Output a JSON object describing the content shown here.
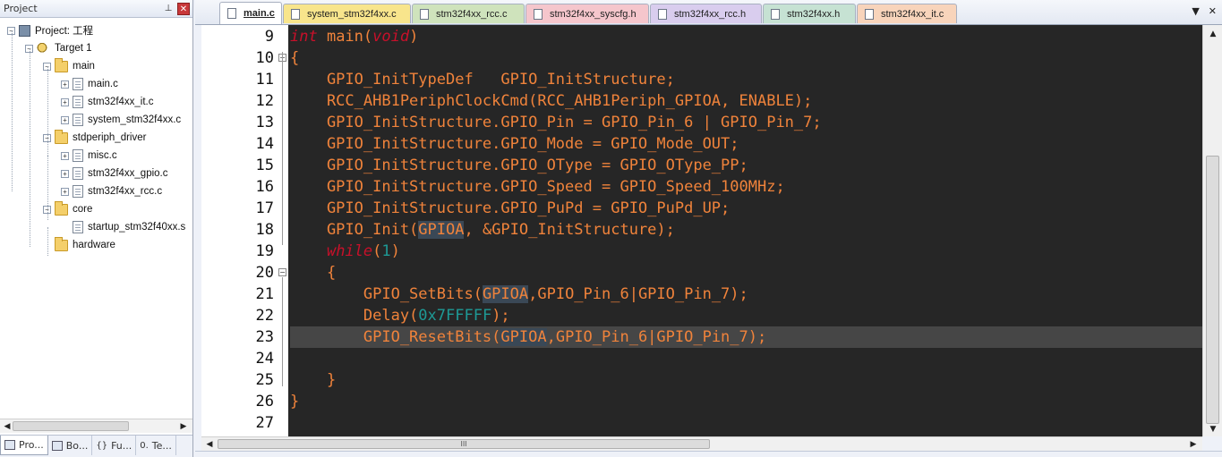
{
  "project_panel": {
    "title": "Project",
    "pin_glyph": "⊥",
    "close_glyph": "✕",
    "tree": [
      {
        "label": "Project: 工程",
        "icon": "project-icon",
        "expander": "−"
      },
      {
        "label": "Target 1",
        "icon": "target-icon",
        "expander": "−"
      },
      {
        "label": "main",
        "icon": "folder-icon",
        "expander": "−"
      },
      {
        "label": "main.c",
        "icon": "file-icon",
        "expander": "+"
      },
      {
        "label": "stm32f4xx_it.c",
        "icon": "file-icon",
        "expander": "+"
      },
      {
        "label": "system_stm32f4xx.c",
        "icon": "file-icon",
        "expander": "+"
      },
      {
        "label": "stdperiph_driver",
        "icon": "folder-icon",
        "expander": "−"
      },
      {
        "label": "misc.c",
        "icon": "file-icon",
        "expander": "+"
      },
      {
        "label": "stm32f4xx_gpio.c",
        "icon": "file-icon",
        "expander": "+"
      },
      {
        "label": "stm32f4xx_rcc.c",
        "icon": "file-icon",
        "expander": "+"
      },
      {
        "label": "core",
        "icon": "folder-icon",
        "expander": "−"
      },
      {
        "label": "startup_stm32f40xx.s",
        "icon": "file-icon",
        "expander": ""
      },
      {
        "label": "hardware",
        "icon": "folder-icon",
        "expander": ""
      }
    ],
    "bottom_tabs": [
      {
        "label": "Pro...",
        "icon": "project-tab-icon"
      },
      {
        "label": "Bo...",
        "icon": "books-tab-icon"
      },
      {
        "label": "Fu...",
        "icon": "functions-tab-icon",
        "glyph": "{}"
      },
      {
        "label": "Te...",
        "icon": "templates-tab-icon",
        "glyph": "0."
      }
    ]
  },
  "editor_tabs": [
    {
      "label": "main.c",
      "color": "#ffffff",
      "active": true
    },
    {
      "label": "system_stm32f4xx.c",
      "color": "#f8e58c"
    },
    {
      "label": "stm32f4xx_rcc.c",
      "color": "#cfe3bc"
    },
    {
      "label": "stm32f4xx_syscfg.h",
      "color": "#f5c6cc"
    },
    {
      "label": "stm32f4xx_rcc.h",
      "color": "#d9cdee"
    },
    {
      "label": "stm32f4xx.h",
      "color": "#c6e2d3"
    },
    {
      "label": "stm32f4xx_it.c",
      "color": "#f8d4bb"
    }
  ],
  "tab_tools": {
    "dropdown": "▼",
    "close": "✕"
  },
  "code_lines": [
    {
      "n": "9",
      "fold": "",
      "tokens": [
        [
          "kw",
          "int"
        ],
        [
          "t",
          " main("
        ],
        [
          "kw",
          "void"
        ],
        [
          "t",
          ")"
        ]
      ]
    },
    {
      "n": "10",
      "fold": "−",
      "tokens": [
        [
          "t",
          "{"
        ]
      ]
    },
    {
      "n": "11",
      "fold": "",
      "tokens": [
        [
          "t",
          "    GPIO_InitTypeDef   GPIO_InitStructure;"
        ]
      ]
    },
    {
      "n": "12",
      "fold": "",
      "tokens": [
        [
          "t",
          "    RCC_AHB1PeriphClockCmd(RCC_AHB1Periph_GPIOA, ENABLE);"
        ]
      ]
    },
    {
      "n": "13",
      "fold": "",
      "tokens": [
        [
          "t",
          "    GPIO_InitStructure.GPIO_Pin = GPIO_Pin_6 | GPIO_Pin_7;"
        ]
      ]
    },
    {
      "n": "14",
      "fold": "",
      "tokens": [
        [
          "t",
          "    GPIO_InitStructure.GPIO_Mode = GPIO_Mode_OUT;"
        ]
      ]
    },
    {
      "n": "15",
      "fold": "",
      "tokens": [
        [
          "t",
          "    GPIO_InitStructure.GPIO_OType = GPIO_OType_PP;"
        ]
      ]
    },
    {
      "n": "16",
      "fold": "",
      "tokens": [
        [
          "t",
          "    GPIO_InitStructure.GPIO_Speed = GPIO_Speed_100MHz;"
        ]
      ]
    },
    {
      "n": "17",
      "fold": "",
      "tokens": [
        [
          "t",
          "    GPIO_InitStructure.GPIO_PuPd = GPIO_PuPd_UP;"
        ]
      ]
    },
    {
      "n": "18",
      "fold": "",
      "tokens": [
        [
          "t",
          "    GPIO_Init("
        ],
        [
          "hl",
          "GPIOA"
        ],
        [
          "t",
          ", &GPIO_InitStructure);"
        ]
      ]
    },
    {
      "n": "19",
      "fold": "",
      "tokens": [
        [
          "t",
          "    "
        ],
        [
          "kw",
          "while"
        ],
        [
          "t",
          "("
        ],
        [
          "num",
          "1"
        ],
        [
          "t",
          ")"
        ]
      ]
    },
    {
      "n": "20",
      "fold": "−",
      "tokens": [
        [
          "t",
          "    {"
        ]
      ]
    },
    {
      "n": "21",
      "fold": "",
      "tokens": [
        [
          "t",
          "        GPIO_SetBits("
        ],
        [
          "hl",
          "GPIOA"
        ],
        [
          "t",
          ",GPIO_Pin_6|GPIO_Pin_7);"
        ]
      ]
    },
    {
      "n": "22",
      "fold": "",
      "tokens": [
        [
          "t",
          "        Delay("
        ],
        [
          "num",
          "0x7FFFFF"
        ],
        [
          "t",
          ");"
        ]
      ]
    },
    {
      "n": "23",
      "fold": "",
      "current": true,
      "tokens": [
        [
          "t",
          "        GPIO_ResetBits("
        ],
        [
          "hlc",
          "GPIOA"
        ],
        [
          "t",
          ",GPIO_Pin_6|GPIO_Pin_7);"
        ]
      ]
    },
    {
      "n": "24",
      "fold": "",
      "tokens": [
        [
          "t",
          ""
        ]
      ]
    },
    {
      "n": "25",
      "fold": "",
      "tokens": [
        [
          "t",
          "    }"
        ]
      ]
    },
    {
      "n": "26",
      "fold": "",
      "tokens": [
        [
          "t",
          "}"
        ]
      ]
    },
    {
      "n": "27",
      "fold": "",
      "tokens": [
        [
          "t",
          ""
        ]
      ]
    }
  ],
  "colors": {
    "editor_bg": "#262626",
    "code_text": "#f0833b",
    "keyword": "#c8102a",
    "number": "#1e9a96",
    "current_line": "#464646"
  },
  "scroll": {
    "up": "▲",
    "down": "▼",
    "left": "◀",
    "right": "▶",
    "grip": "III"
  }
}
